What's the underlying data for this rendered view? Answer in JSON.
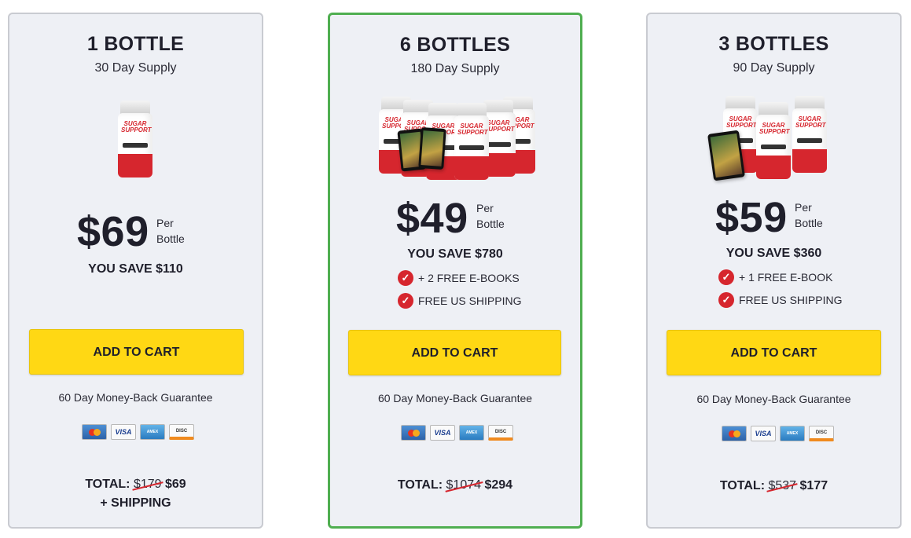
{
  "plans": [
    {
      "title": "1 BOTTLE",
      "supply": "30 Day Supply",
      "price": "$69",
      "per_line1": "Per",
      "per_line2": "Bottle",
      "save": "YOU SAVE $110",
      "perks": [],
      "cta": "ADD TO CART",
      "guarantee": "60 Day Money-Back Guarantee",
      "total_label": "TOTAL:",
      "total_old": "$179",
      "total_new": "$69",
      "shipping": "+ SHIPPING"
    },
    {
      "title": "6 BOTTLES",
      "supply": "180 Day Supply",
      "price": "$49",
      "per_line1": "Per",
      "per_line2": "Bottle",
      "save": "YOU SAVE $780",
      "perks": [
        "+ 2 FREE E-BOOKS",
        "FREE US SHIPPING"
      ],
      "cta": "ADD TO CART",
      "guarantee": "60 Day Money-Back Guarantee",
      "total_label": "TOTAL:",
      "total_old": "$1074",
      "total_new": "$294",
      "featured": true
    },
    {
      "title": "3 BOTTLES",
      "supply": "90 Day Supply",
      "price": "$59",
      "per_line1": "Per",
      "per_line2": "Bottle",
      "save": "YOU SAVE $360",
      "perks": [
        "+ 1 FREE E-BOOK",
        "FREE US SHIPPING"
      ],
      "cta": "ADD TO CART",
      "guarantee": "60 Day Money-Back Guarantee",
      "total_label": "TOTAL:",
      "total_old": "$537",
      "total_new": "$177"
    }
  ],
  "product": {
    "label_line1": "SUGAR",
    "label_line2": "SUPPORT"
  },
  "payment_cards": [
    "MasterCard",
    "VISA",
    "AMERICAN EXPRESS",
    "DISCOVER"
  ],
  "colors": {
    "accent_green": "#4fae50",
    "cta_yellow": "#ffd814",
    "brand_red": "#d6262e",
    "card_bg": "#eef0f5"
  },
  "icons": {
    "check": "check-circle-icon"
  }
}
